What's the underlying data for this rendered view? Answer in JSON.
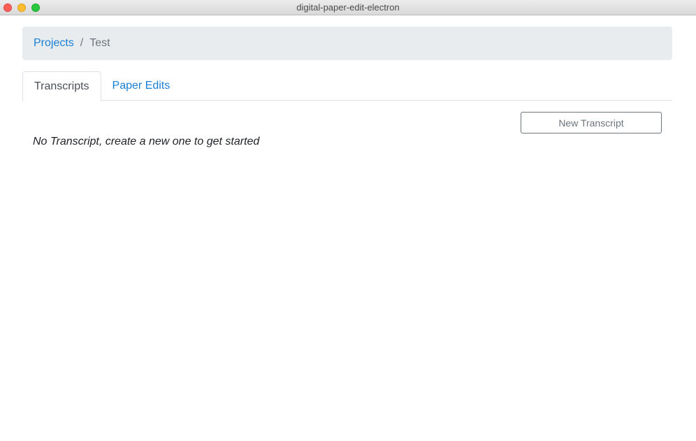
{
  "window": {
    "title": "digital-paper-edit-electron"
  },
  "breadcrumb": {
    "items": [
      {
        "label": "Projects",
        "link": true
      },
      {
        "label": "Test",
        "link": false
      }
    ],
    "separator": "/"
  },
  "tabs": [
    {
      "label": "Transcripts",
      "active": true
    },
    {
      "label": "Paper Edits",
      "active": false
    }
  ],
  "content": {
    "new_button_label": "New Transcript",
    "empty_message": "No Transcript, create a new one to get started"
  },
  "colors": {
    "link": "#1a7fd4",
    "breadcrumb_bg": "#e9ecef",
    "muted": "#6c757d"
  }
}
